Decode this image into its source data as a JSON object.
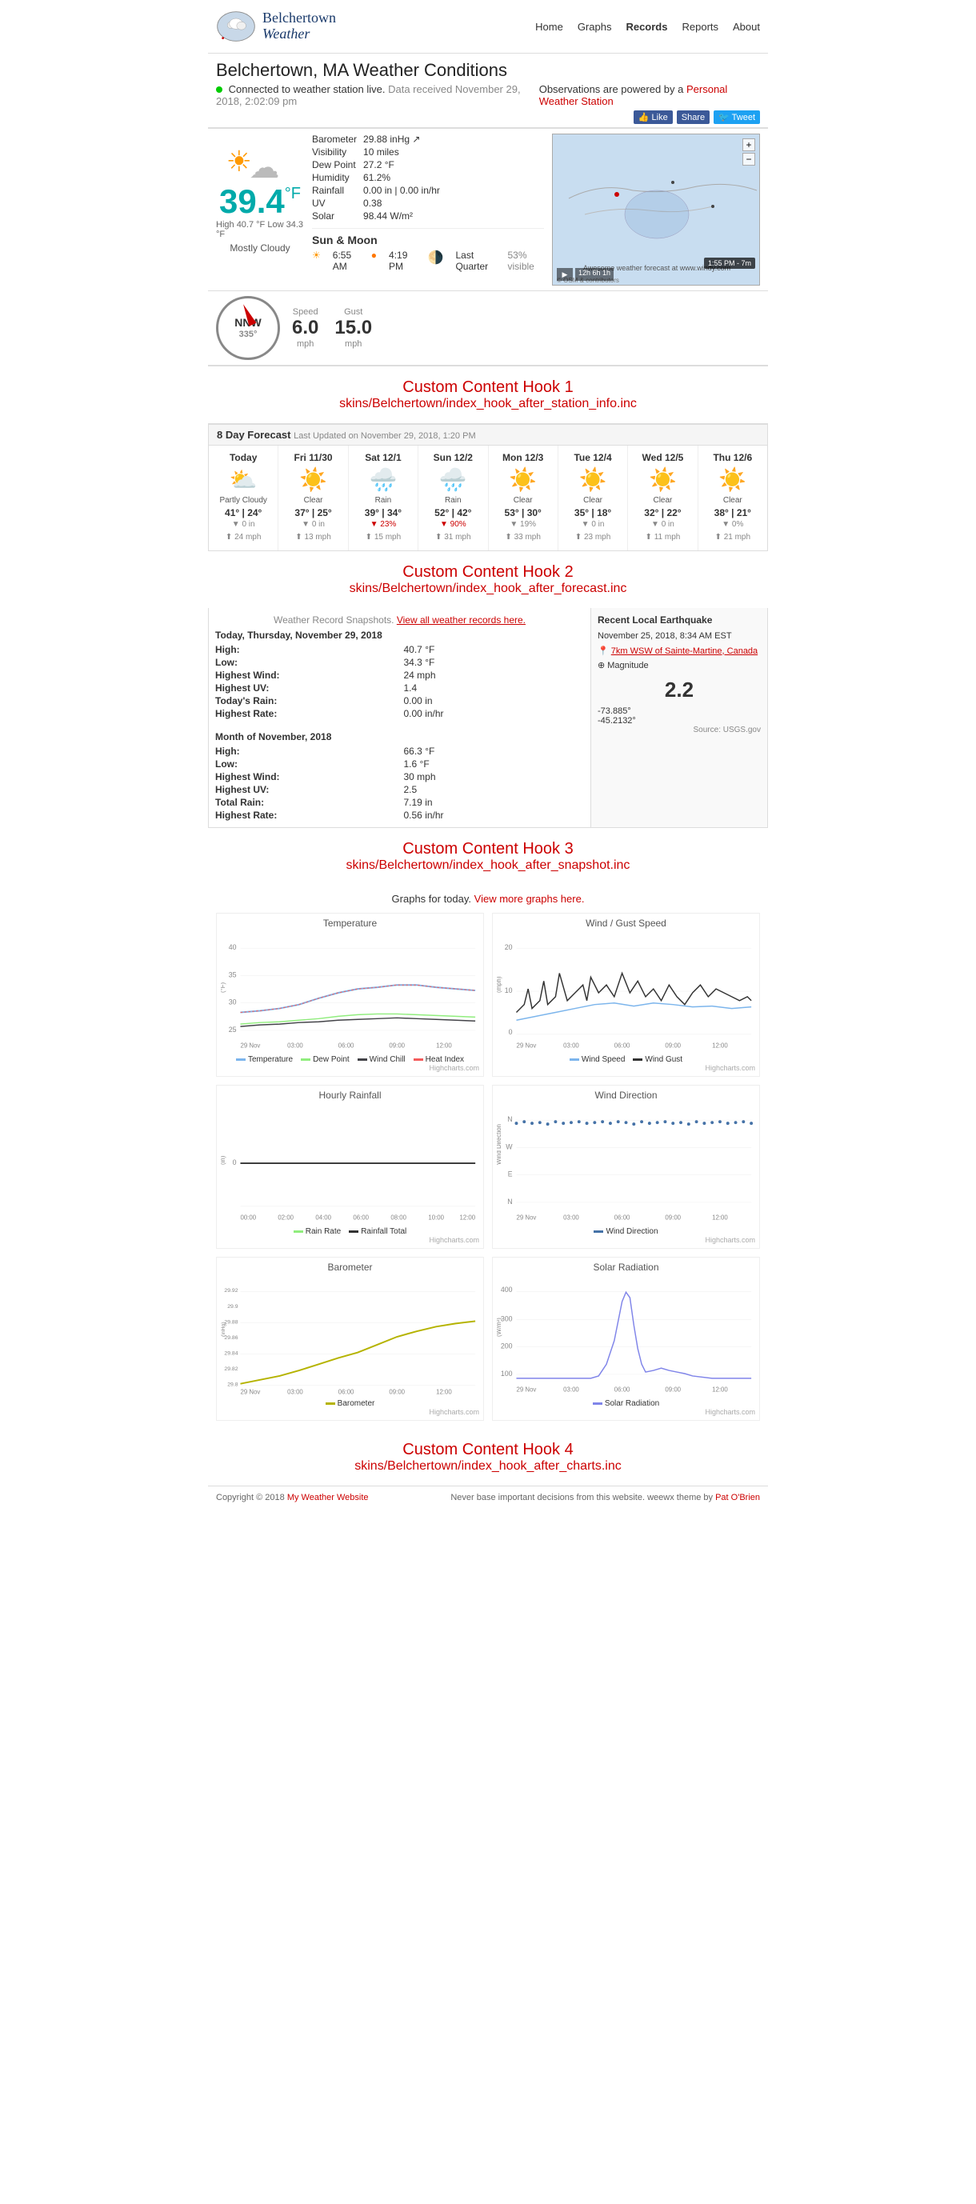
{
  "nav": {
    "logo_text_line1": "Belchertown",
    "logo_text_line2": "Weather",
    "links": [
      {
        "label": "Home",
        "active": true
      },
      {
        "label": "Graphs",
        "active": false
      },
      {
        "label": "Records",
        "active": false
      },
      {
        "label": "Reports",
        "active": false
      },
      {
        "label": "About",
        "active": false
      }
    ]
  },
  "header": {
    "title": "Belchertown, MA Weather Conditions",
    "connected_text": "Connected to weather station live.",
    "data_received": "Data received November 29, 2018, 2:02:09 pm",
    "pws_text": "Observations are powered by a",
    "pws_link": "Personal Weather Station"
  },
  "social": {
    "fb_like": "Like",
    "fb_share": "Share",
    "tw_tweet": "Tweet"
  },
  "conditions": {
    "temperature": "39.4",
    "temp_unit": "°F",
    "high": "40.7 °F",
    "low": "34.3 °F",
    "condition": "Mostly Cloudy",
    "barometer": "29.88 inHg ↗",
    "visibility": "10 miles",
    "dew_point": "27.2 °F",
    "humidity": "61.2%",
    "rainfall": "0.00 in | 0.00 in/hr",
    "uv": "0.38",
    "solar": "98.44 W/m²"
  },
  "sun_moon": {
    "title": "Sun & Moon",
    "sunrise": "6:55 AM",
    "sunset": "4:19 PM",
    "moon_phase": "Last Quarter",
    "moon_visible": "53% visible"
  },
  "wind": {
    "direction": "NNW",
    "degrees": "335°",
    "speed": "6.0",
    "gust": "15.0",
    "unit": "mph"
  },
  "custom_hook_1": {
    "title": "Custom Content Hook 1",
    "path": "skins/Belchertown/index_hook_after_station_info.inc"
  },
  "forecast": {
    "header": "8 Day Forecast",
    "last_updated": "Last Updated on November 29, 2018, 1:20 PM",
    "days": [
      {
        "name": "Today",
        "icon": "⛅",
        "condition": "Partly Cloudy",
        "high": "41",
        "low": "24",
        "precip": "0 in",
        "wind": "24 mph",
        "color": "normal"
      },
      {
        "name": "Fri 11/30",
        "icon": "☀️",
        "condition": "Clear",
        "high": "37",
        "low": "25",
        "precip": "0 in",
        "wind": "13 mph",
        "color": "normal"
      },
      {
        "name": "Sat 12/1",
        "icon": "🌧️",
        "condition": "Rain",
        "high": "39",
        "low": "34",
        "precip": "23%",
        "wind": "15 mph",
        "color": "rain"
      },
      {
        "name": "Sun 12/2",
        "icon": "🌧️",
        "condition": "Rain",
        "high": "52",
        "low": "42",
        "precip": "90%",
        "wind": "31 mph",
        "color": "rain"
      },
      {
        "name": "Mon 12/3",
        "icon": "☀️",
        "condition": "Clear",
        "high": "53",
        "low": "30",
        "precip": "19%",
        "wind": "33 mph",
        "color": "normal"
      },
      {
        "name": "Tue 12/4",
        "icon": "☀️",
        "condition": "Clear",
        "high": "35",
        "low": "18",
        "precip": "0 in",
        "wind": "23 mph",
        "color": "normal"
      },
      {
        "name": "Wed 12/5",
        "icon": "☀️",
        "condition": "Clear",
        "high": "32",
        "low": "22",
        "precip": "0 in",
        "wind": "11 mph",
        "color": "normal"
      },
      {
        "name": "Thu 12/6",
        "icon": "☀️",
        "condition": "Clear",
        "high": "38",
        "low": "21",
        "precip": "0%",
        "wind": "21 mph",
        "color": "normal"
      }
    ]
  },
  "custom_hook_2": {
    "title": "Custom Content Hook 2",
    "path": "skins/Belchertown/index_hook_after_forecast.inc"
  },
  "records": {
    "title": "Weather Record Snapshots.",
    "view_link": "View all weather records here.",
    "today_date": "Today, Thursday, November 29, 2018",
    "today": {
      "high_label": "High:",
      "high": "40.7 °F",
      "low_label": "Low:",
      "low": "34.3 °F",
      "highest_wind_label": "Highest Wind:",
      "highest_wind": "24 mph",
      "highest_uv_label": "Highest UV:",
      "highest_uv": "1.4",
      "todays_rain_label": "Today's Rain:",
      "todays_rain": "0.00 in",
      "highest_rate_label": "Highest Rate:",
      "highest_rate": "0.00 in/hr"
    },
    "month_date": "Month of November, 2018",
    "month": {
      "high_label": "High:",
      "high": "66.3 °F",
      "low_label": "Low:",
      "low": "1.6 °F",
      "highest_wind_label": "Highest Wind:",
      "highest_wind": "30 mph",
      "highest_uv_label": "Highest UV:",
      "highest_uv": "2.5",
      "total_rain_label": "Total Rain:",
      "total_rain": "7.19 in",
      "highest_rate_label": "Highest Rate:",
      "highest_rate": "0.56 in/hr"
    }
  },
  "earthquake": {
    "title": "Recent Local Earthquake",
    "date": "November 25, 2018, 8:34 AM EST",
    "location": "7km WSW of Sainte-Martine, Canada",
    "magnitude_label": "Magnitude",
    "magnitude": "2.2",
    "long": "-73.885°",
    "lat": "-45.2132°",
    "source": "Source: USGS.gov"
  },
  "custom_hook_3": {
    "title": "Custom Content Hook 3",
    "path": "skins/Belchertown/index_hook_after_snapshot.inc"
  },
  "graphs": {
    "title": "Graphs for today.",
    "view_link": "View more graphs here.",
    "temp_chart_title": "Temperature",
    "wind_chart_title": "Wind / Gust Speed",
    "rainfall_chart_title": "Hourly Rainfall",
    "wind_dir_chart_title": "Wind Direction",
    "baro_chart_title": "Barometer",
    "solar_chart_title": "Solar Radiation",
    "legend_temp": [
      "Temperature",
      "Dew Point",
      "Wind Chill",
      "Heat Index"
    ],
    "legend_wind": [
      "Wind Speed",
      "Wind Gust"
    ],
    "legend_rain": [
      "Rain Rate",
      "Rainfall Total"
    ],
    "legend_baro": [
      "Barometer"
    ],
    "legend_solar": [
      "Solar Radiation"
    ],
    "x_labels_main": [
      "29 Nov",
      "03:00",
      "06:00",
      "09:00",
      "12:00"
    ],
    "y_temp": [
      25,
      30,
      35,
      40
    ],
    "y_wind": [
      0,
      10,
      20
    ],
    "highcharts_credit": "Highcharts.com"
  },
  "custom_hook_4": {
    "title": "Custom Content Hook 4",
    "path": "skins/Belchertown/index_hook_after_charts.inc"
  },
  "footer": {
    "copyright": "Copyright © 2018",
    "site_name": "My Weather Website",
    "disclaimer": "Never base important decisions from this website.",
    "theme": "weewx theme by",
    "theme_author": "Pat O'Brien"
  }
}
